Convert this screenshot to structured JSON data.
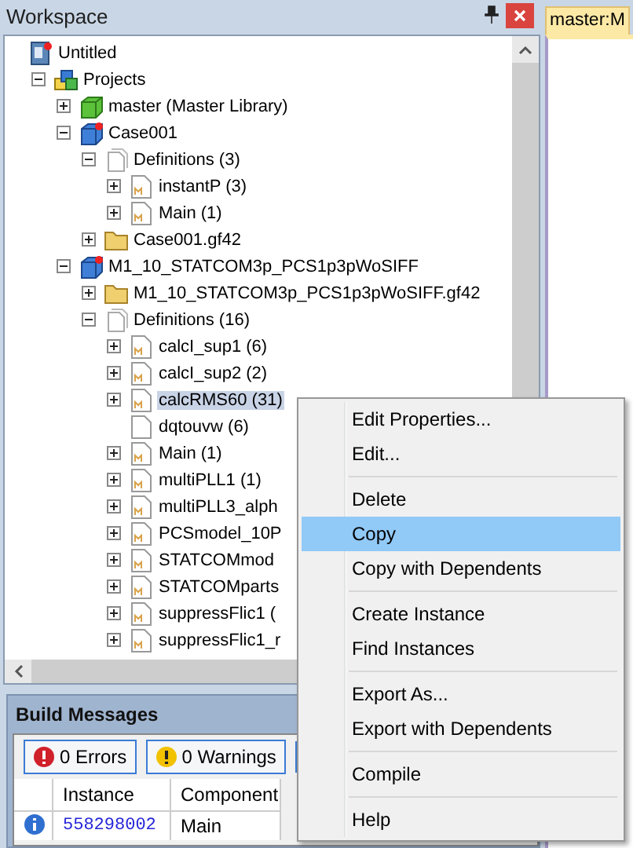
{
  "workspace": {
    "title": "Workspace",
    "tree": [
      {
        "label": "Untitled",
        "kind": "workspace",
        "selected": false,
        "children": [
          {
            "label": "Projects",
            "kind": "projects",
            "expanded": true,
            "selected": false,
            "children": [
              {
                "label": "master (Master Library)",
                "kind": "library",
                "expanded": false,
                "selected": false
              },
              {
                "label": "Case001",
                "kind": "case",
                "expanded": true,
                "selected": false,
                "children": [
                  {
                    "label": "Definitions (3)",
                    "kind": "definitions",
                    "expanded": true,
                    "selected": false,
                    "children": [
                      {
                        "label": "instantP (3)",
                        "kind": "module",
                        "expanded": false,
                        "selected": false
                      },
                      {
                        "label": "Main (1)",
                        "kind": "module",
                        "expanded": false,
                        "selected": false
                      }
                    ]
                  },
                  {
                    "label": "Case001.gf42",
                    "kind": "folder",
                    "expanded": false,
                    "selected": false
                  }
                ]
              },
              {
                "label": "M1_10_STATCOM3p_PCS1p3pWoSIFF",
                "kind": "case",
                "expanded": true,
                "selected": false,
                "children": [
                  {
                    "label": "M1_10_STATCOM3p_PCS1p3pWoSIFF.gf42",
                    "kind": "folder",
                    "expanded": false,
                    "selected": false
                  },
                  {
                    "label": "Definitions (16)",
                    "kind": "definitions",
                    "expanded": true,
                    "selected": false,
                    "children": [
                      {
                        "label": "calcI_sup1 (6)",
                        "kind": "module",
                        "expanded": false,
                        "selected": false
                      },
                      {
                        "label": "calcI_sup2 (2)",
                        "kind": "module",
                        "expanded": false,
                        "selected": false
                      },
                      {
                        "label": "calcRMS60 (31)",
                        "kind": "module",
                        "expanded": false,
                        "selected": true
                      },
                      {
                        "label": "dqtouvw (6)",
                        "kind": "page",
                        "selected": false
                      },
                      {
                        "label": "Main (1)",
                        "kind": "module",
                        "expanded": false,
                        "selected": false
                      },
                      {
                        "label": "multiPLL1 (1)",
                        "kind": "module",
                        "expanded": false,
                        "selected": false
                      },
                      {
                        "label": "multiPLL3_alph",
                        "kind": "module",
                        "expanded": false,
                        "selected": false
                      },
                      {
                        "label": "PCSmodel_10P",
                        "kind": "module",
                        "expanded": false,
                        "selected": false
                      },
                      {
                        "label": "STATCOMmod",
                        "kind": "module",
                        "expanded": false,
                        "selected": false
                      },
                      {
                        "label": "STATCOMparts",
                        "kind": "module",
                        "expanded": false,
                        "selected": false
                      },
                      {
                        "label": "suppressFlic1 (",
                        "kind": "module",
                        "expanded": false,
                        "selected": false
                      },
                      {
                        "label": "suppressFlic1_r",
                        "kind": "module",
                        "expanded": false,
                        "selected": false
                      }
                    ]
                  }
                ]
              }
            ]
          }
        ]
      }
    ]
  },
  "document_tab": {
    "label": "master:M"
  },
  "context_menu": {
    "groups": [
      [
        {
          "label": "Edit Properties...",
          "selected": false
        },
        {
          "label": "Edit...",
          "selected": false
        }
      ],
      [
        {
          "label": "Delete",
          "selected": false
        },
        {
          "label": "Copy",
          "selected": true
        },
        {
          "label": "Copy with Dependents",
          "selected": false
        }
      ],
      [
        {
          "label": "Create Instance",
          "selected": false
        },
        {
          "label": "Find Instances",
          "selected": false
        }
      ],
      [
        {
          "label": "Export As...",
          "selected": false
        },
        {
          "label": "Export with Dependents",
          "selected": false
        }
      ],
      [
        {
          "label": "Compile",
          "selected": false
        }
      ],
      [
        {
          "label": "Help",
          "selected": false
        }
      ]
    ]
  },
  "build_messages": {
    "title": "Build Messages",
    "filters": [
      {
        "label": "0 Errors",
        "kind": "error"
      },
      {
        "label": "0 Warnings",
        "kind": "warning"
      }
    ],
    "columns": [
      "Instance",
      "Component"
    ],
    "rows": [
      {
        "kind": "info",
        "instance": "558298002",
        "component": "Main"
      }
    ]
  }
}
